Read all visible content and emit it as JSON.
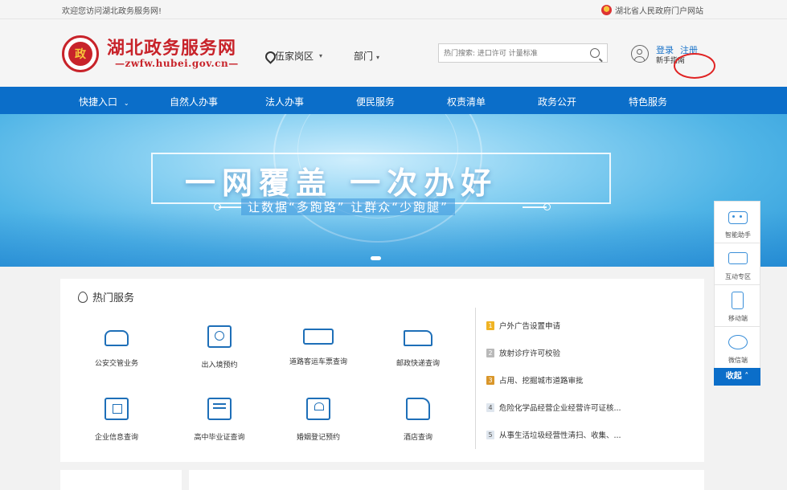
{
  "topbar": {
    "welcome": "欢迎您访问湖北政务服务网!",
    "portal_link": "湖北省人民政府门户网站"
  },
  "header": {
    "logo_title": "湖北政务服务网",
    "logo_subtitle": "—zwfw.hubei.gov.cn—",
    "location": "伍家岗区",
    "department": "部门",
    "search_placeholder": "热门搜索: 进口许可 计量标准",
    "login": "登录",
    "register": "注册",
    "guide": "新手指南"
  },
  "nav": {
    "items": [
      "快捷入口",
      "自然人办事",
      "法人办事",
      "便民服务",
      "权责清单",
      "政务公开",
      "特色服务"
    ]
  },
  "banner": {
    "title": "一网覆盖  一次办好",
    "subtitle": "让数据“多跑路”  让群众“少跑腿”"
  },
  "sidetools": {
    "items": [
      "智能助手",
      "互动专区",
      "移动端",
      "微信端"
    ],
    "collapse": "收起"
  },
  "hot_services": {
    "title": "热门服务",
    "services": [
      {
        "label": "公安交管业务",
        "icon": "car-icon"
      },
      {
        "label": "出入境预约",
        "icon": "passport-icon"
      },
      {
        "label": "道路客运车票查询",
        "icon": "ticket-icon"
      },
      {
        "label": "邮政快递查询",
        "icon": "truck-icon"
      },
      {
        "label": "企业信息查询",
        "icon": "enterprise-chart-icon"
      },
      {
        "label": "高中毕业证查询",
        "icon": "certificate-icon"
      },
      {
        "label": "婚姻登记预约",
        "icon": "marriage-icon"
      },
      {
        "label": "酒店查询",
        "icon": "hotel-icon"
      }
    ],
    "ranking": [
      {
        "num": "1",
        "text": "户外广告设置申请"
      },
      {
        "num": "2",
        "text": "放射诊疗许可校验"
      },
      {
        "num": "3",
        "text": "占用、挖掘城市道路审批"
      },
      {
        "num": "4",
        "text": "危险化学品经营企业经营许可证核..."
      },
      {
        "num": "5",
        "text": "从事生活垃圾经营性清扫、收集、..."
      }
    ]
  },
  "colors": {
    "nav_blue": "#0b6ec9",
    "brand_red": "#c8232a",
    "link_blue": "#1a73c9"
  }
}
